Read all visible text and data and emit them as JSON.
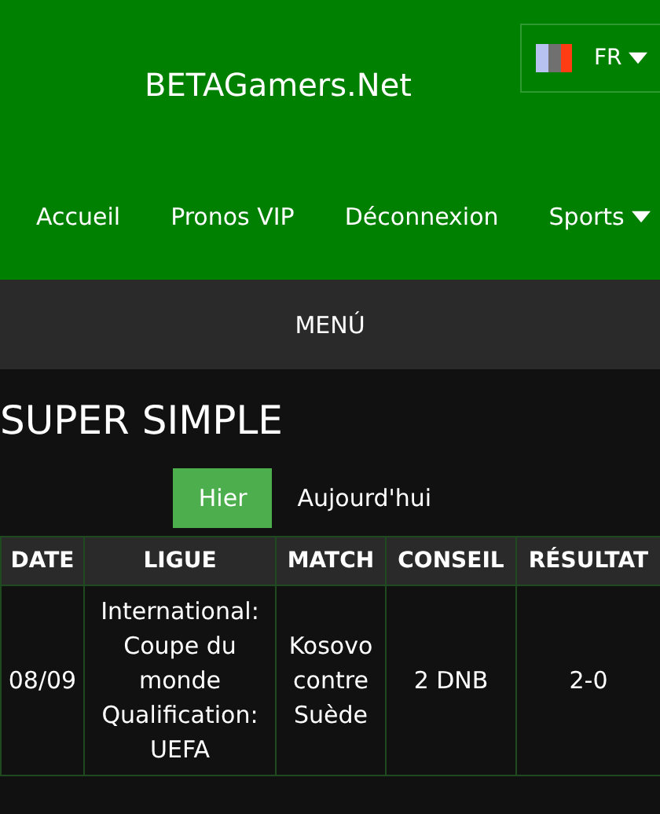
{
  "header": {
    "brand": "BETAGamers.Net",
    "language": {
      "code": "FR"
    },
    "nav": [
      {
        "label": "Accueil",
        "kind": "link"
      },
      {
        "label": "Pronos VIP",
        "kind": "link"
      },
      {
        "label": "Déconnexion",
        "kind": "link"
      },
      {
        "label": "Sports",
        "kind": "dropdown"
      }
    ]
  },
  "menu_bar": {
    "label": "MENÚ"
  },
  "page_title": "SUPER SIMPLE",
  "tabs": [
    {
      "label": "Hier",
      "selected": true
    },
    {
      "label": "Aujourd'hui",
      "selected": false
    }
  ],
  "table": {
    "columns": [
      "DATE",
      "LIGUE",
      "MATCH",
      "CONSEIL",
      "RÉSULTAT"
    ],
    "rows": [
      [
        "08/09",
        "International: Coupe du monde Qualification: UEFA",
        "Kosovo contre Suède",
        "2 DNB",
        "2-0"
      ]
    ]
  }
}
